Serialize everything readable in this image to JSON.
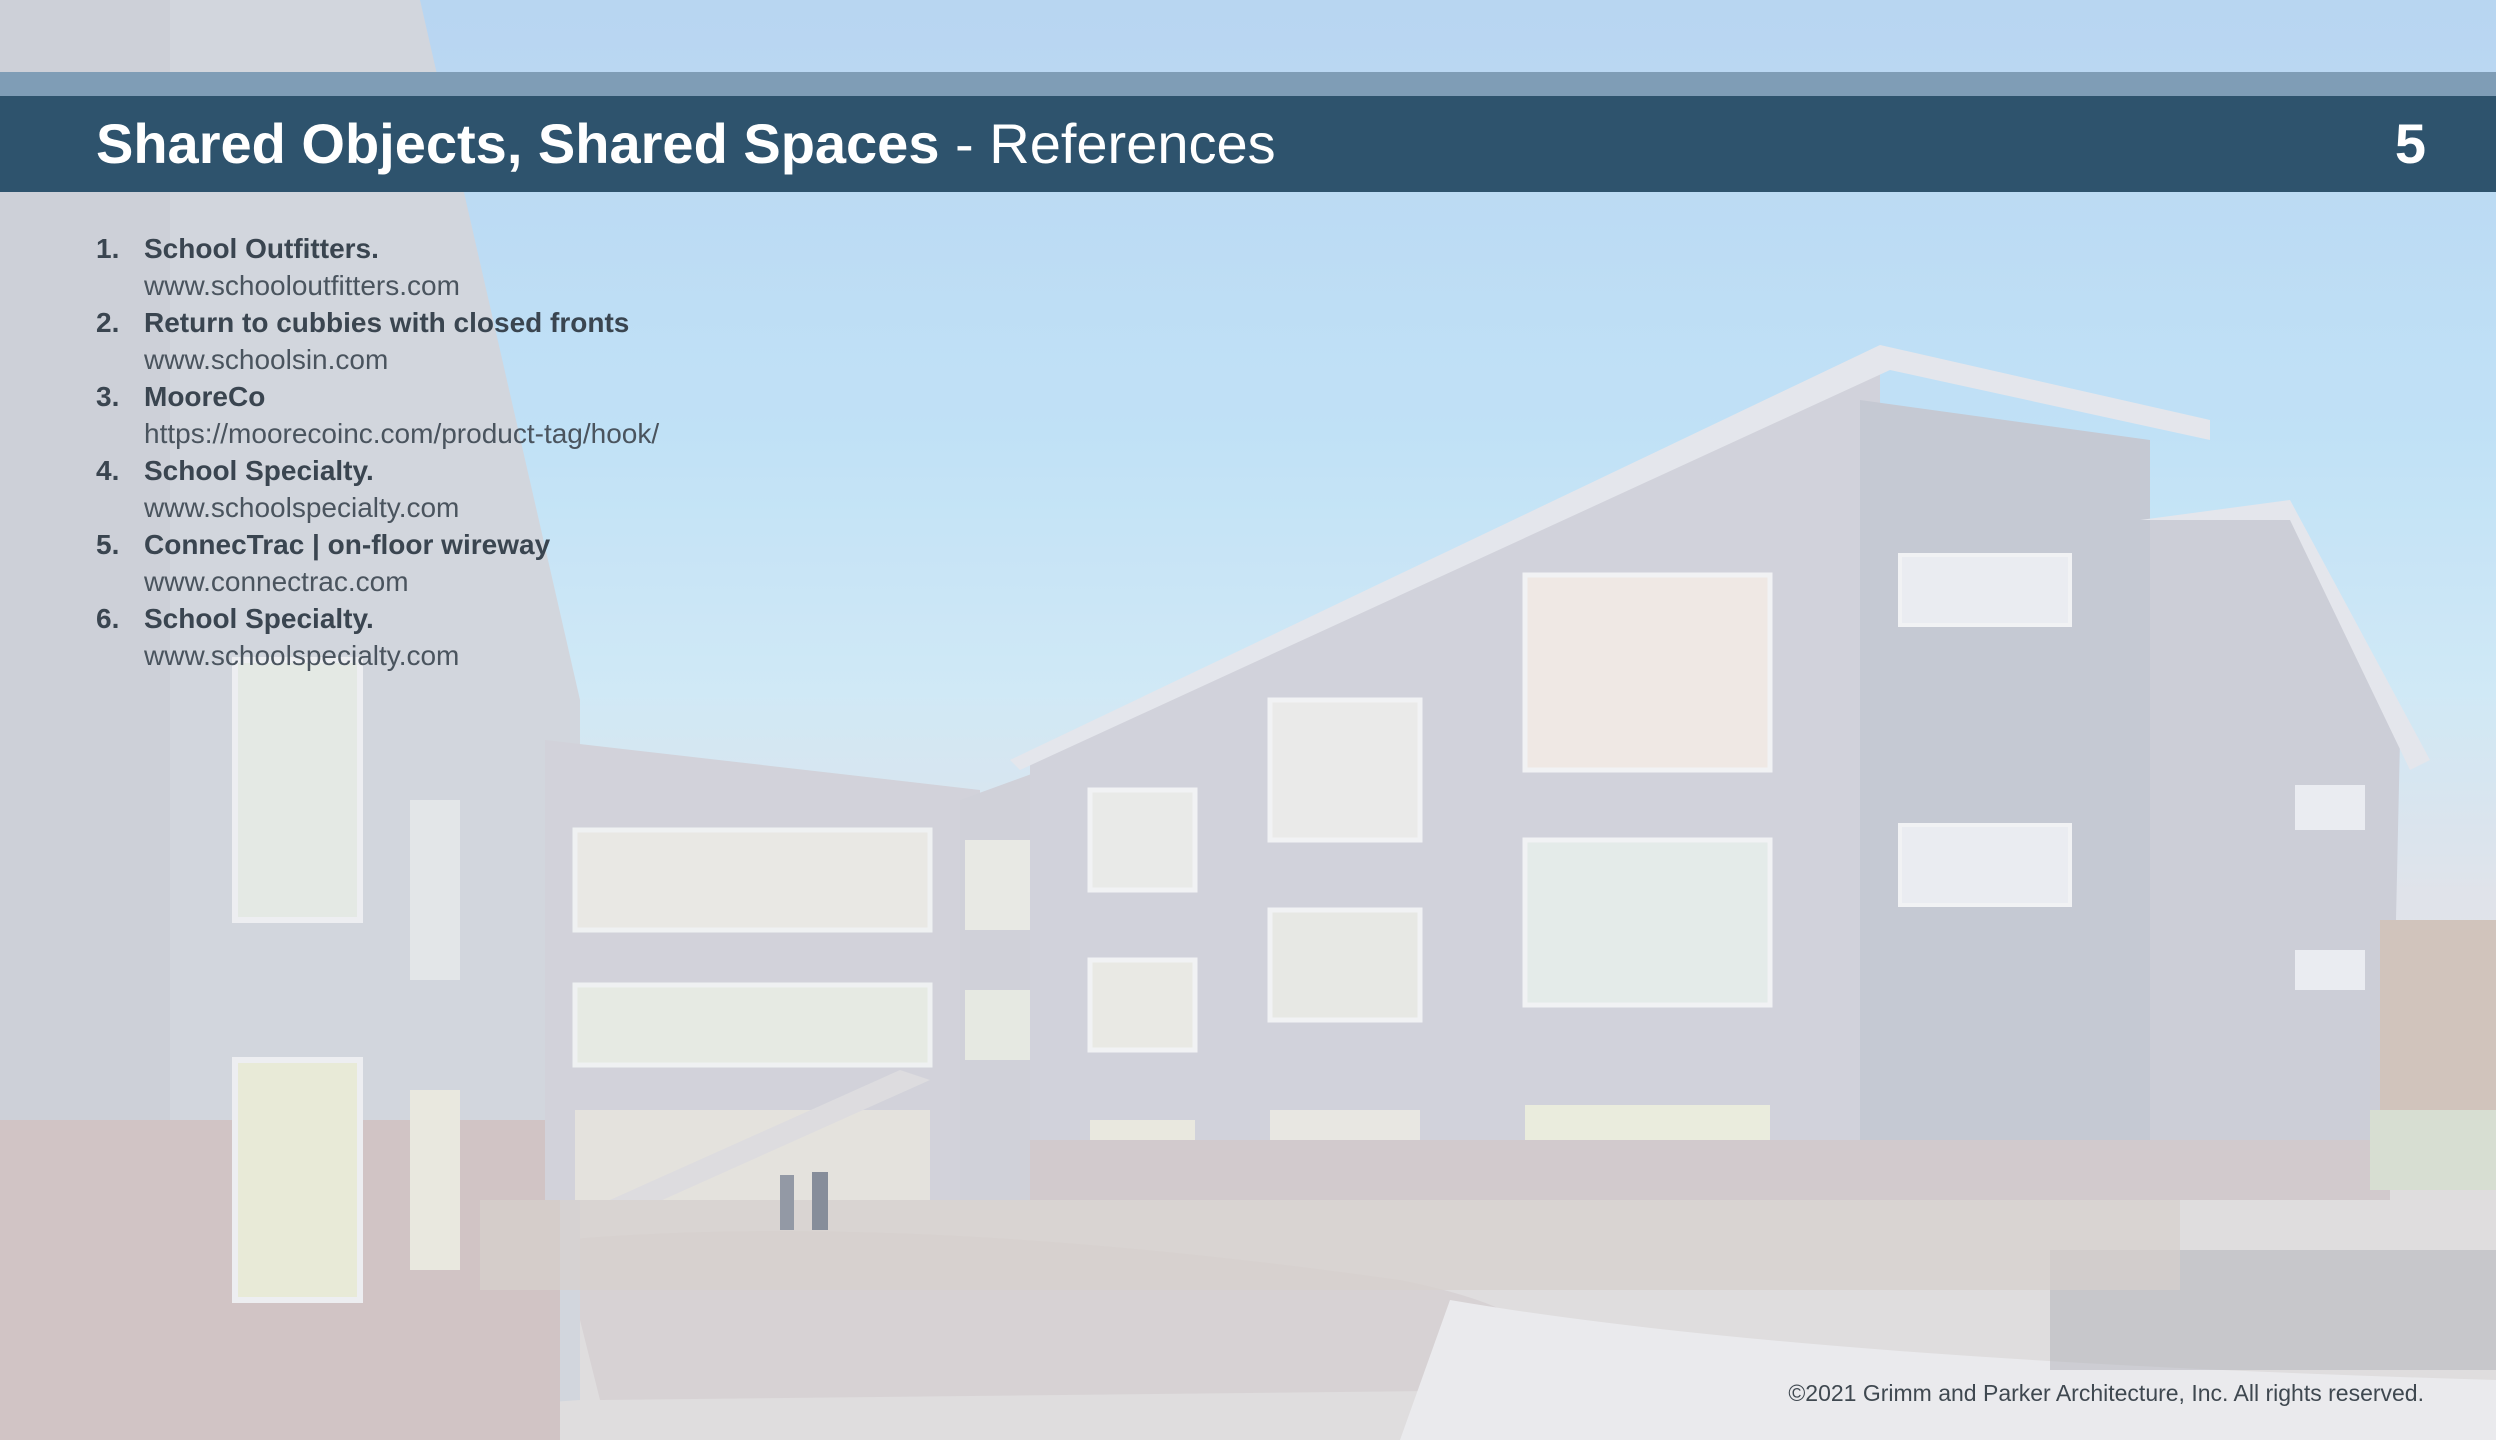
{
  "header": {
    "title_bold": "Shared Objects, Shared Spaces",
    "title_rest": " - References",
    "page_number": "5"
  },
  "references": [
    {
      "number": "1.",
      "title": "School Outfitters.",
      "url": "www.schooloutfitters.com"
    },
    {
      "number": "2.",
      "title": "Return to cubbies with closed fronts",
      "url": "www.schoolsin.com"
    },
    {
      "number": "3.",
      "title": "MooreCo",
      "url": "https://moorecoinc.com/product-tag/hook/"
    },
    {
      "number": "4.",
      "title": "School Specialty.",
      "url": "www.schoolspecialty.com"
    },
    {
      "number": "5.",
      "title": "ConnecTrac | on-floor wireway",
      "url": "www.connectrac.com"
    },
    {
      "number": "6.",
      "title": "School Specialty.",
      "url": "www.schoolspecialty.com"
    }
  ],
  "footer": {
    "copyright": "©2021 Grimm and Parker Architecture, Inc. All rights reserved."
  },
  "colors": {
    "title_bar": "#2e536d",
    "top_strip": "#7f9db6",
    "sky": "#b3dbf5",
    "text": "#3a4550"
  }
}
